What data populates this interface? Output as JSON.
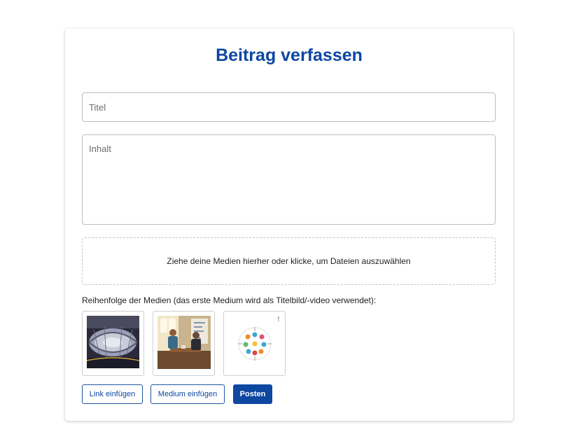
{
  "form": {
    "heading": "Beitrag verfassen",
    "title_placeholder": "Titel",
    "content_placeholder": "Inhalt",
    "dropzone_text": "Ziehe deine Medien hierher oder klicke, um Dateien auszuwählen",
    "media_order_label": "Reihenfolge der Medien (das erste Medium wird als Titelbild/-video verwendet):"
  },
  "media": [
    {
      "name": "panorama-image"
    },
    {
      "name": "meeting-image"
    },
    {
      "name": "icon-graphic-image",
      "move_up_icon": "↑"
    }
  ],
  "buttons": {
    "insert_link": "Link einfügen",
    "insert_media": "Medium einfügen",
    "post": "Posten"
  },
  "colors": {
    "accent": "#0d47a1",
    "border": "#bdbdbd"
  }
}
